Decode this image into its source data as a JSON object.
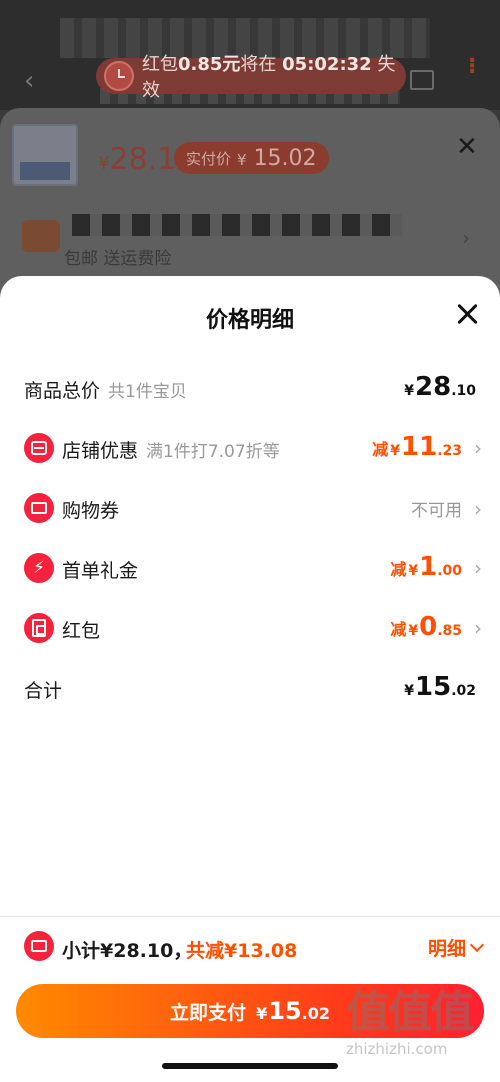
{
  "background": {
    "timer": {
      "prefix": "红包",
      "amount": "0.85元",
      "middle": "将在",
      "countdown": "05:02:32",
      "suffix": "失效"
    },
    "product": {
      "price_yen": "¥",
      "price": "28.1",
      "paid_label": "实付价",
      "paid_yen": "¥",
      "paid_value": "15.02"
    },
    "shipping": {
      "insurance_text": "包邮 送运费险"
    }
  },
  "sheet": {
    "title": "价格明细",
    "rows": [
      {
        "label": "商品总价",
        "desc": "共1件宝贝",
        "yen": "¥",
        "int": "28",
        "dec": ".10"
      },
      {
        "label": "店铺优惠",
        "desc": "满1件打7.07折等",
        "prefix": "减",
        "yen": "¥",
        "int": "11",
        "dec": ".23"
      },
      {
        "label": "购物券",
        "status": "不可用"
      },
      {
        "label": "首单礼金",
        "prefix": "减",
        "yen": "¥",
        "int": "1",
        "dec": ".00"
      },
      {
        "label": "红包",
        "prefix": "减",
        "yen": "¥",
        "int": "0",
        "dec": ".85"
      },
      {
        "label": "合计",
        "yen": "¥",
        "int": "15",
        "dec": ".02"
      }
    ]
  },
  "footer": {
    "subtotal": "小计¥28.10，",
    "reduce": "共减¥13.08",
    "detail": "明细",
    "pay_label": "立即支付",
    "pay_yen": "¥",
    "pay_int": "15",
    "pay_dec": ".02"
  },
  "watermark": {
    "logo": "值值值",
    "domain": "zhizhizhi.com"
  },
  "colors": {
    "accent": "#ff5000",
    "icon_red": "#f5223d"
  }
}
